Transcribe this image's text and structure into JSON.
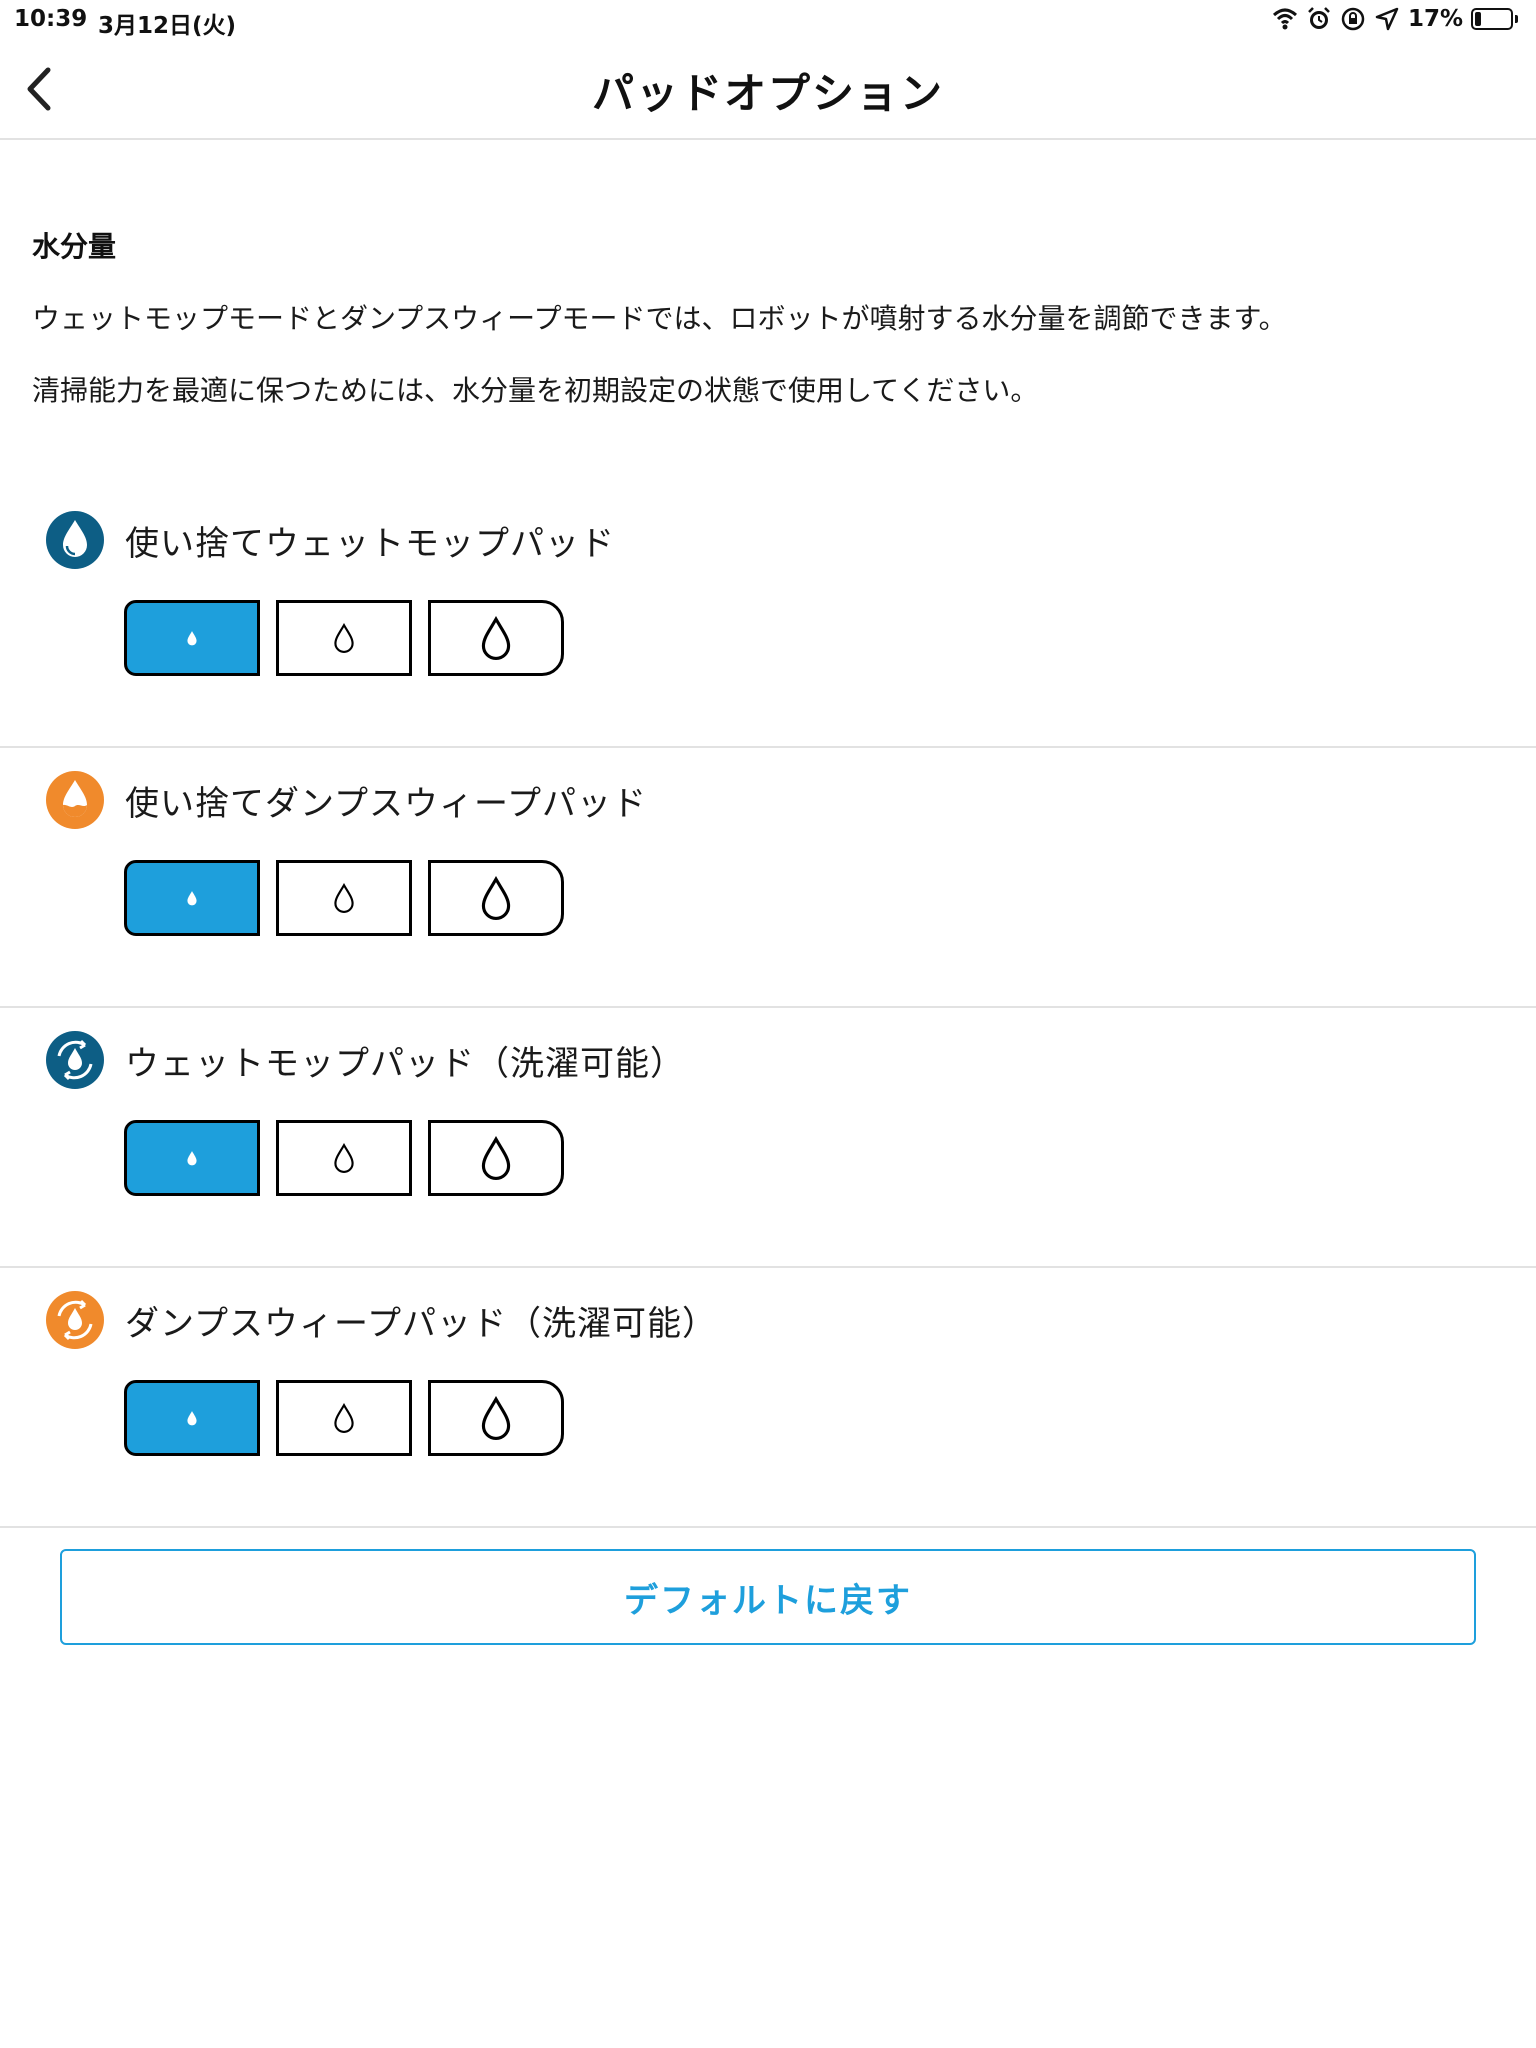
{
  "status_bar": {
    "time": "10:39",
    "date": "3月12日(火)",
    "battery_text": "17%",
    "battery_level": 0.17,
    "icons": [
      "wifi-icon",
      "alarm-icon",
      "rotation-lock-icon",
      "location-icon"
    ]
  },
  "navbar": {
    "title": "パッドオプション",
    "back_icon": "chevron-left-icon"
  },
  "section": {
    "title": "水分量",
    "description_1": "ウェットモップモードとダンプスウィープモードでは、ロボットが噴射する水分量を調節できます。",
    "description_2": "清掃能力を最適に保つためには、水分量を初期設定の状態で使用してください。"
  },
  "pads": [
    {
      "label": "使い捨てウェットモップパッド",
      "icon": "disposable-wet-mop-icon",
      "icon_color": "#0d5e85",
      "selected_level": 1
    },
    {
      "label": "使い捨てダンプスウィープパッド",
      "icon": "disposable-damp-sweep-icon",
      "icon_color": "#f08a2c",
      "selected_level": 1
    },
    {
      "label": "ウェットモップパッド（洗濯可能）",
      "icon": "washable-wet-mop-icon",
      "icon_color": "#0d5e85",
      "selected_level": 1
    },
    {
      "label": "ダンプスウィープパッド（洗濯可能）",
      "icon": "washable-damp-sweep-icon",
      "icon_color": "#f08a2c",
      "selected_level": 1
    }
  ],
  "levels": [
    "low-water-drop-icon",
    "medium-water-drop-icon",
    "high-water-drop-icon"
  ],
  "reset_button": {
    "label": "デフォルトに戻す"
  },
  "colors": {
    "accent": "#1e9fdc",
    "divider": "#e2e2e2"
  }
}
